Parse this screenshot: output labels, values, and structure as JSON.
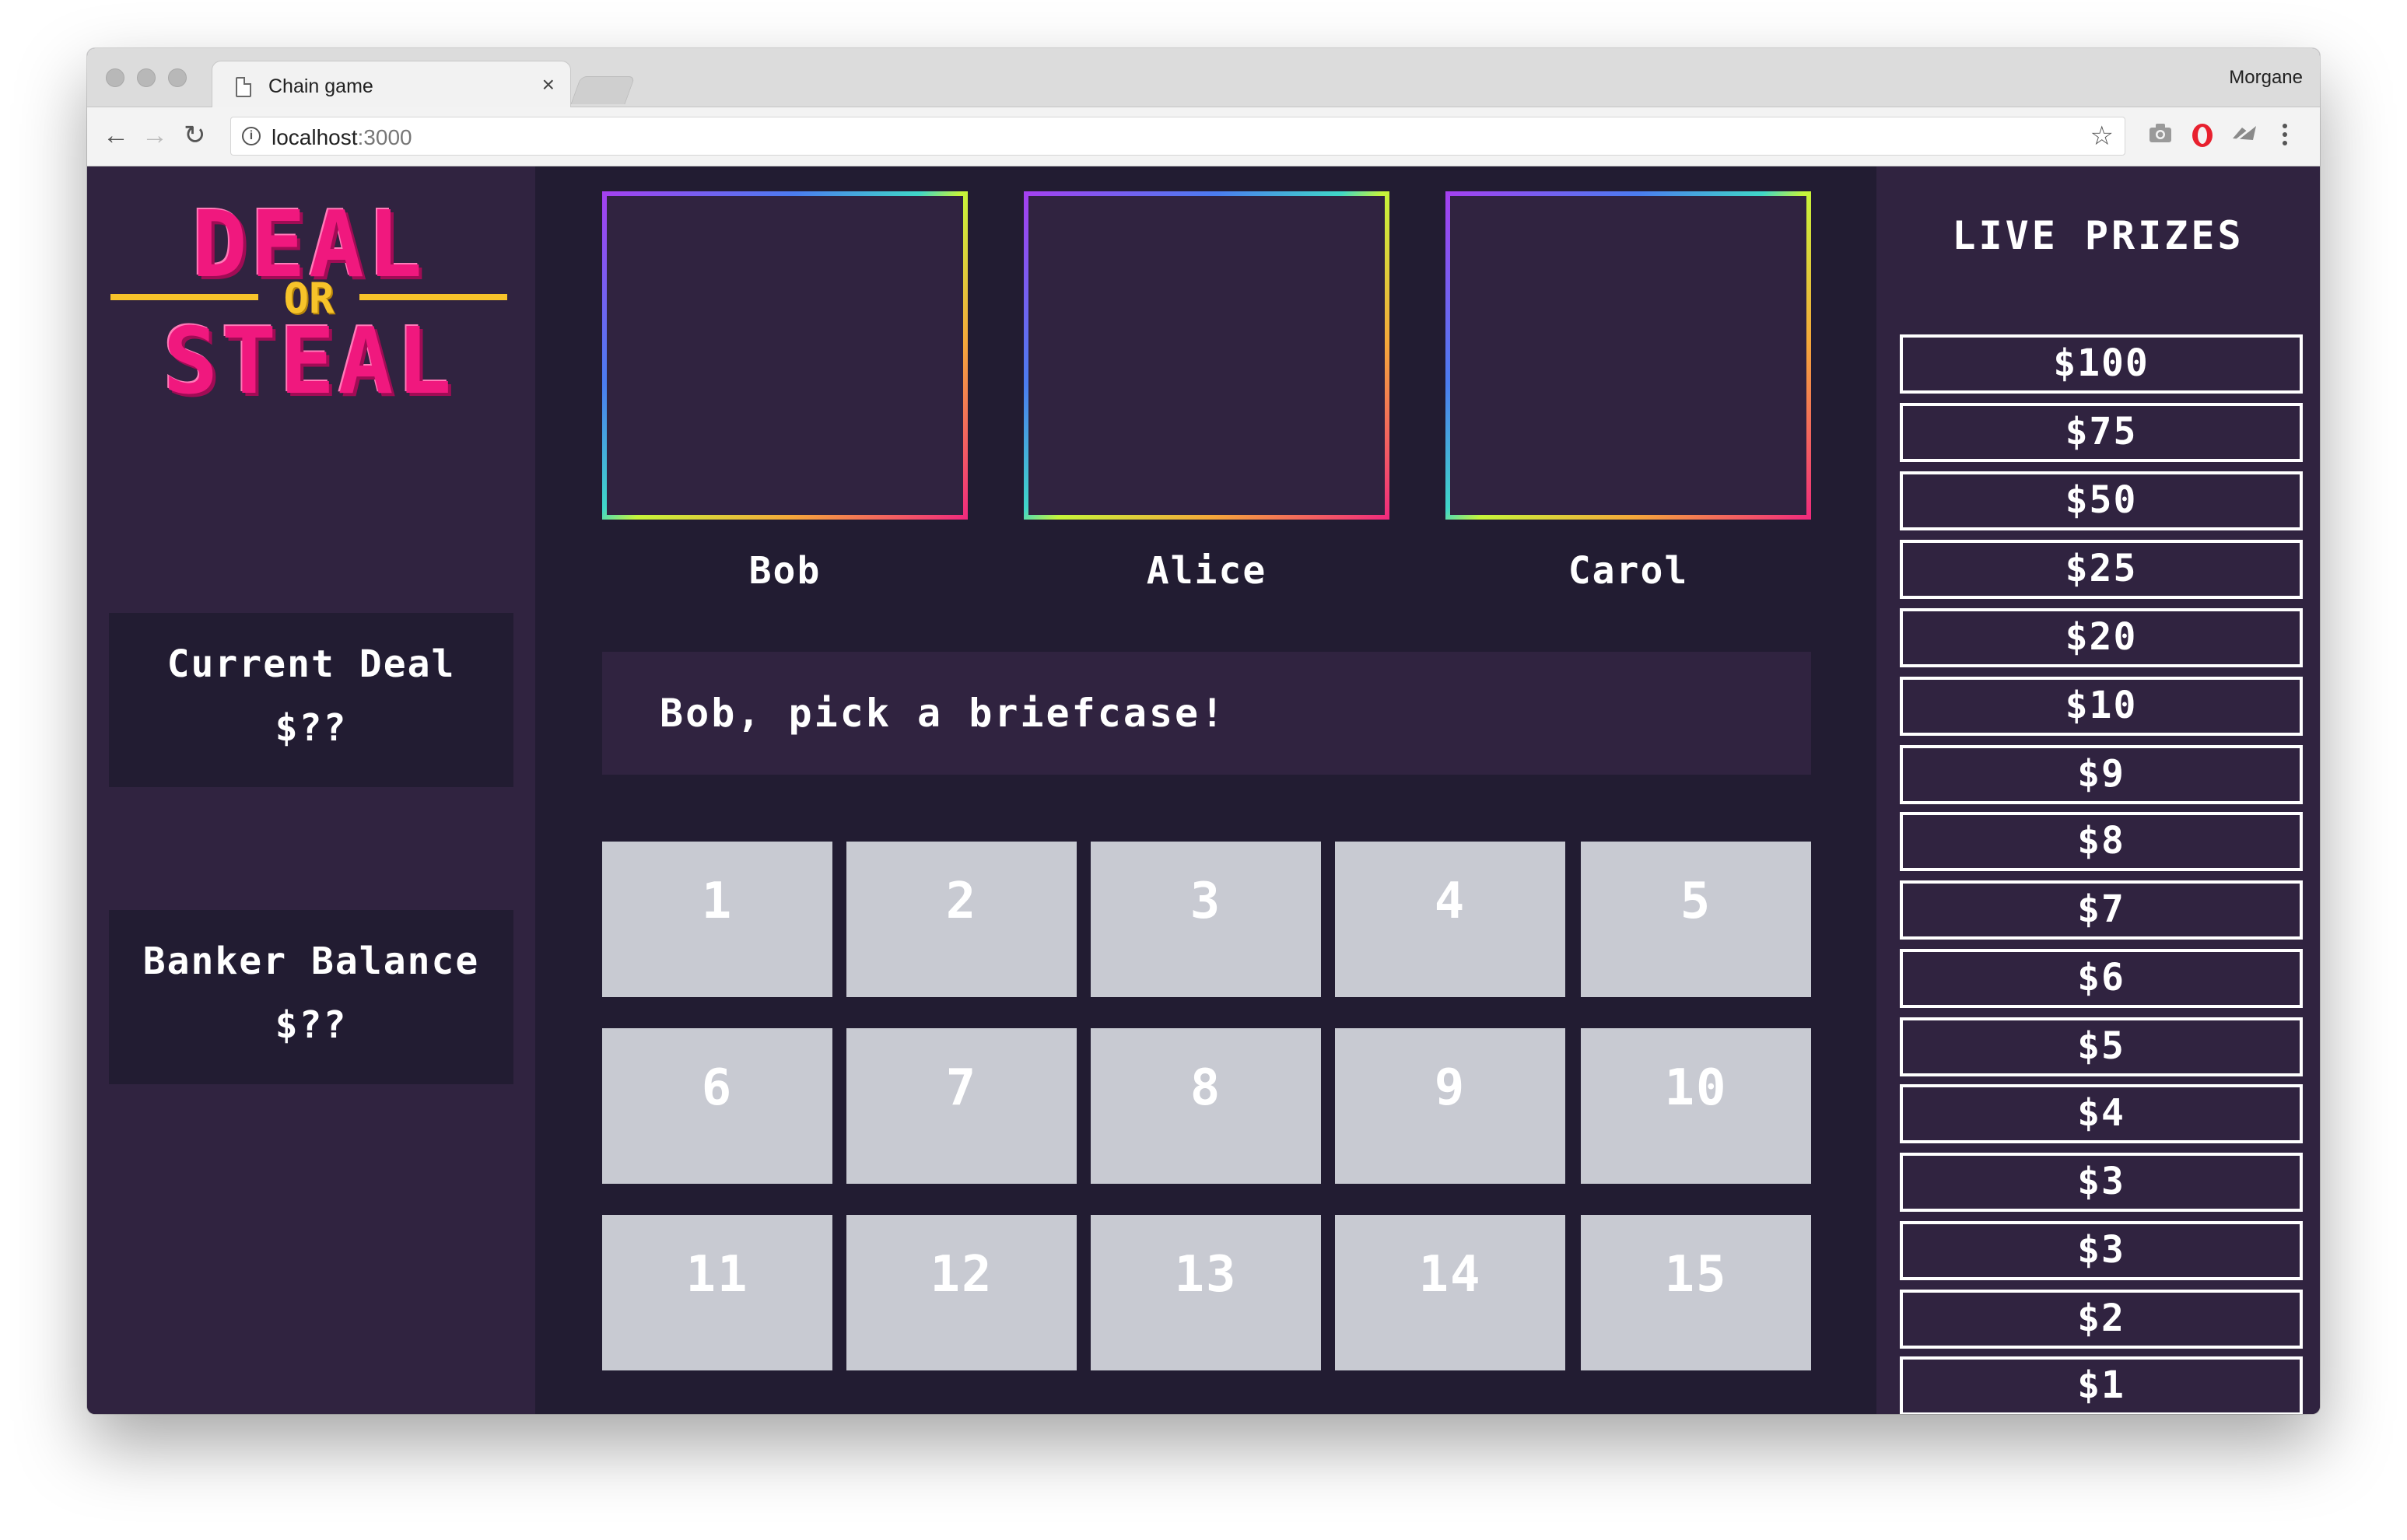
{
  "browser": {
    "tab_title": "Chain game",
    "tab_close": "×",
    "profile_name": "Morgane",
    "url_host": "localhost",
    "url_port": ":3000",
    "back": "←",
    "forward": "→",
    "reload": "↻",
    "star": "☆",
    "info": "i"
  },
  "logo": {
    "line1": "DEAL",
    "line2": "OR",
    "line3": "STEAL"
  },
  "current_deal": {
    "label": "Current Deal",
    "value": "$??"
  },
  "banker_balance": {
    "label": "Banker Balance",
    "value": "$??"
  },
  "players": [
    "Bob",
    "Alice",
    "Carol"
  ],
  "message": "Bob, pick a briefcase!",
  "briefcases": [
    "1",
    "2",
    "3",
    "4",
    "5",
    "6",
    "7",
    "8",
    "9",
    "10",
    "11",
    "12",
    "13",
    "14",
    "15"
  ],
  "prizes_title": "LIVE PRIZES",
  "prizes": [
    "$100",
    "$75",
    "$50",
    "$25",
    "$20",
    "$10",
    "$9",
    "$8",
    "$7",
    "$6",
    "$5",
    "$4",
    "$3",
    "$3",
    "$2",
    "$1"
  ],
  "colors": {
    "panel": "#302340",
    "center": "#221c32",
    "logo_pink": "#f0187e",
    "logo_yellow": "#f7c32a",
    "briefcase": "#c8cad2"
  }
}
